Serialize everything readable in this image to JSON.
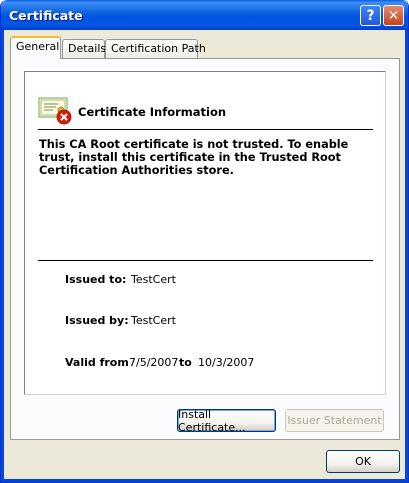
{
  "window": {
    "title": "Certificate",
    "help_button": "?",
    "close_button": "✕"
  },
  "tabs": [
    {
      "label": "General",
      "active": true
    },
    {
      "label": "Details",
      "active": false
    },
    {
      "label": "Certification Path",
      "active": false
    }
  ],
  "info": {
    "icon": "certificate-error-icon",
    "heading": "Certificate Information",
    "message": "This CA Root certificate is not trusted. To enable trust, install this certificate in the Trusted Root Certification Authorities store."
  },
  "fields": {
    "issued_to_label": "Issued to:",
    "issued_to_value": "TestCert",
    "issued_by_label": "Issued by:",
    "issued_by_value": "TestCert",
    "valid_from_label": "Valid from",
    "valid_from_value": "7/5/2007",
    "to_label": "to",
    "valid_to_value": "10/3/2007"
  },
  "buttons": {
    "install": "Install Certificate...",
    "issuer": "Issuer Statement",
    "ok": "OK"
  },
  "colors": {
    "titlebar": "#0a5fdc",
    "window_bg": "#ece9d8",
    "error_badge": "#d81e05",
    "active_tab_accent": "#f8b830"
  }
}
